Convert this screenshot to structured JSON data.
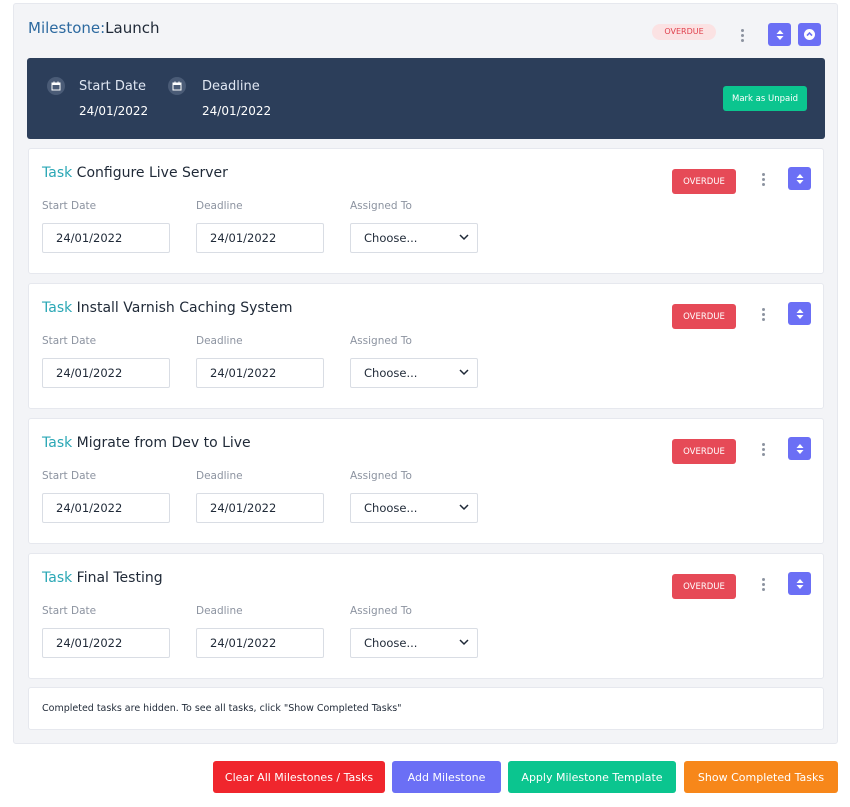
{
  "milestone": {
    "label": "Milestone:",
    "name": "Launch",
    "status": "OVERDUE",
    "start_label": "Start Date",
    "start_value": "24/01/2022",
    "deadline_label": "Deadline",
    "deadline_value": "24/01/2022",
    "mark_unpaid": "Mark as Unpaid"
  },
  "task_label": "Task",
  "field_labels": {
    "start": "Start Date",
    "deadline": "Deadline",
    "assigned": "Assigned To"
  },
  "tasks": [
    {
      "name": "Configure Live Server",
      "status": "OVERDUE",
      "start": "24/01/2022",
      "deadline": "24/01/2022",
      "assigned": "Choose..."
    },
    {
      "name": "Install Varnish Caching System",
      "status": "OVERDUE",
      "start": "24/01/2022",
      "deadline": "24/01/2022",
      "assigned": "Choose..."
    },
    {
      "name": "Migrate from Dev to Live",
      "status": "OVERDUE",
      "start": "24/01/2022",
      "deadline": "24/01/2022",
      "assigned": "Choose..."
    },
    {
      "name": "Final Testing",
      "status": "OVERDUE",
      "start": "24/01/2022",
      "deadline": "24/01/2022",
      "assigned": "Choose..."
    }
  ],
  "note": "Completed tasks are hidden. To see all tasks, click \"Show Completed Tasks\"",
  "actions": {
    "clear": "Clear All Milestones / Tasks",
    "add": "Add Milestone",
    "apply": "Apply Milestone Template",
    "show": "Show Completed Tasks"
  },
  "colors": {
    "accent": "#6b6ff5",
    "overdue": "#e64a57",
    "success": "#0bc58f",
    "danger_btn": "#f0262d",
    "warning_btn": "#f7871a",
    "header_bg": "#2c3e5a"
  }
}
